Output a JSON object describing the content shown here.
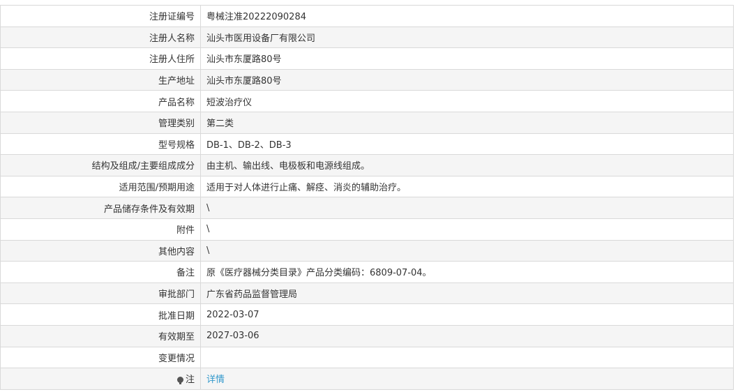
{
  "rows": [
    {
      "label": "注册证编号",
      "value": "粤械注准20222090284"
    },
    {
      "label": "注册人名称",
      "value": "汕头市医用设备厂有限公司"
    },
    {
      "label": "注册人住所",
      "value": "汕头市东厦路80号"
    },
    {
      "label": "生产地址",
      "value": "汕头市东厦路80号"
    },
    {
      "label": "产品名称",
      "value": "短波治疗仪"
    },
    {
      "label": "管理类别",
      "value": "第二类"
    },
    {
      "label": "型号规格",
      "value": "DB-1、DB-2、DB-3"
    },
    {
      "label": "结构及组成/主要组成成分",
      "value": "由主机、输出线、电极板和电源线组成。"
    },
    {
      "label": "适用范围/预期用途",
      "value": "适用于对人体进行止痛、解痉、消炎的辅助治疗。"
    },
    {
      "label": "产品储存条件及有效期",
      "value": "\\"
    },
    {
      "label": "附件",
      "value": "\\"
    },
    {
      "label": "其他内容",
      "value": "\\"
    },
    {
      "label": "备注",
      "value": "原《医疗器械分类目录》产品分类编码：6809-07-04。"
    },
    {
      "label": "审批部门",
      "value": "广东省药品监督管理局"
    },
    {
      "label": "批准日期",
      "value": "2022-03-07"
    },
    {
      "label": "有效期至",
      "value": "2027-03-06"
    },
    {
      "label": "变更情况",
      "value": ""
    }
  ],
  "note_row": {
    "label": "注",
    "icon": "lightbulb-icon",
    "link_text": "详情"
  },
  "colors": {
    "border": "#d9d9d9",
    "alt_row": "#f5f5f5",
    "link": "#3399cc",
    "text": "#333333"
  }
}
